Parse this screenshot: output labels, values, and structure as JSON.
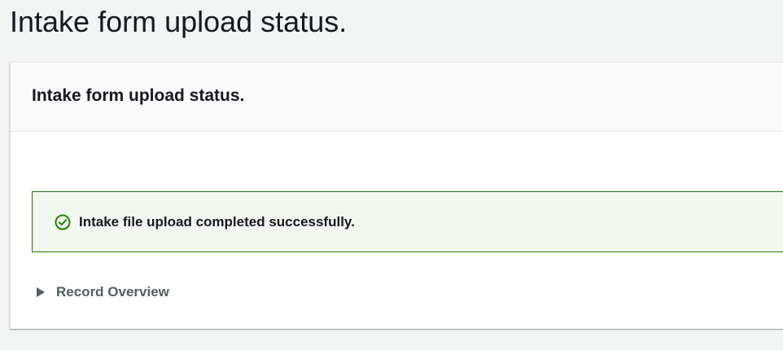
{
  "page": {
    "title": "Intake form upload status."
  },
  "panel": {
    "header_title": "Intake form upload status."
  },
  "alert": {
    "type": "success",
    "icon": "check-circle-icon",
    "message": "Intake file upload completed successfully.",
    "color": "#1d8102",
    "background": "#f2f8f0"
  },
  "expander": {
    "icon": "caret-right-icon",
    "label": "Record Overview",
    "expanded": false
  }
}
